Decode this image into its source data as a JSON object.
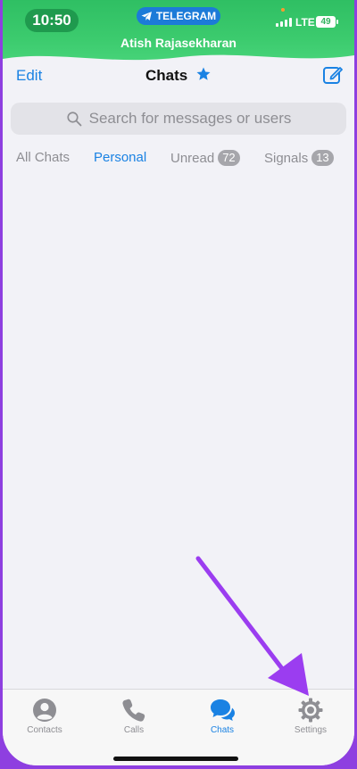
{
  "status_bar": {
    "time": "10:50",
    "app_pill": "TELEGRAM",
    "user": "Atish Rajasekharan",
    "network": "LTE",
    "battery": "49"
  },
  "nav": {
    "edit_label": "Edit",
    "title": "Chats"
  },
  "search": {
    "placeholder": "Search for messages or users"
  },
  "filters": [
    {
      "label": "All Chats"
    },
    {
      "label": "Personal"
    },
    {
      "label": "Unread",
      "badge": "72"
    },
    {
      "label": "Signals",
      "badge": "13"
    }
  ],
  "tabbar": {
    "items": [
      {
        "label": "Contacts",
        "icon": "person-icon"
      },
      {
        "label": "Calls",
        "icon": "phone-icon"
      },
      {
        "label": "Chats",
        "icon": "chat-bubbles-icon"
      },
      {
        "label": "Settings",
        "icon": "gear-icon"
      }
    ]
  },
  "colors": {
    "accent": "#1a82e3",
    "status_green": "#3ccb6e",
    "annotation_arrow": "#9b3df0"
  }
}
